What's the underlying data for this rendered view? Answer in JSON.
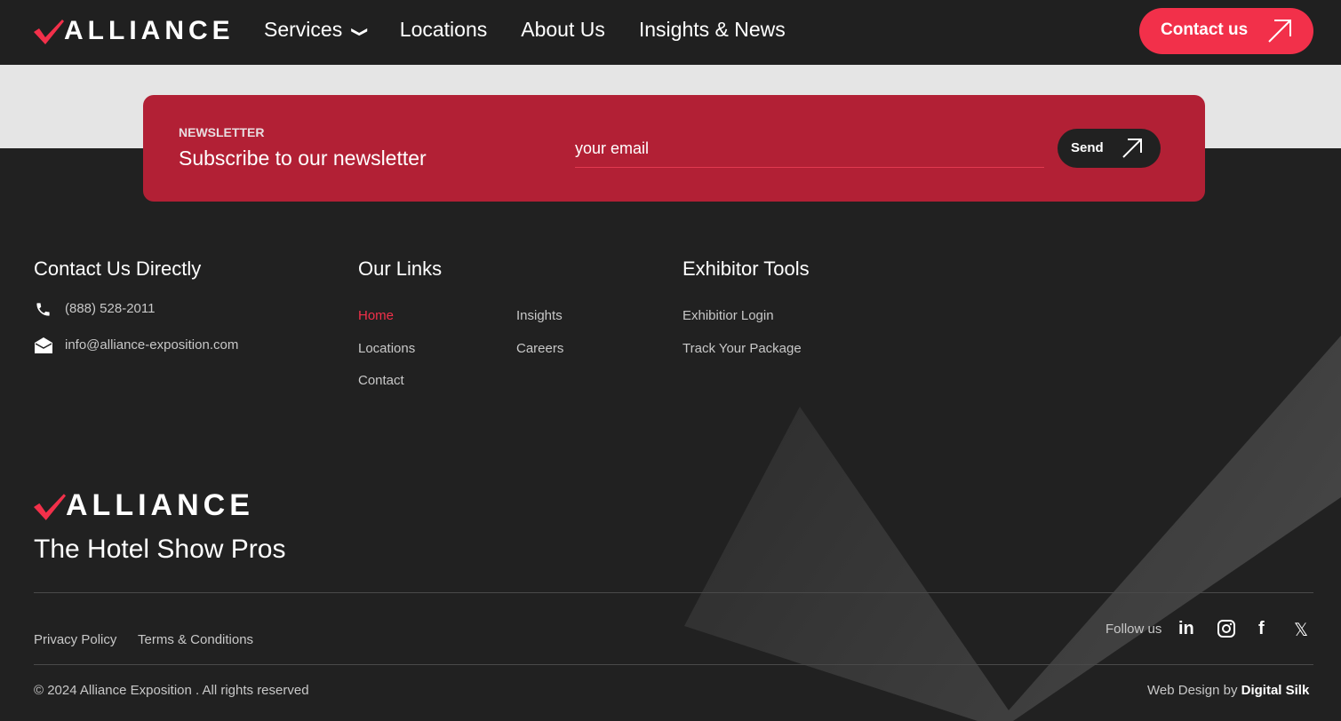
{
  "header": {
    "logo_text": "ALLIANCE",
    "nav": [
      "Services",
      "Locations",
      "About Us",
      "Insights & News"
    ],
    "cta": "Contact us"
  },
  "newsletter": {
    "label": "NEWSLETTER",
    "title": "Subscribe to our newsletter",
    "email_placeholder": "your email",
    "send": "Send"
  },
  "contact": {
    "title": "Contact Us Directly",
    "phone": "(888) 528-2011",
    "email": "info@alliance-exposition.com"
  },
  "links": {
    "title": "Our Links",
    "items": [
      "Home",
      "Insights",
      "Locations",
      "Careers",
      "Contact"
    ]
  },
  "tools": {
    "title": "Exhibitor Tools",
    "items": [
      "Exhibitior Login",
      "Track Your Package"
    ]
  },
  "footer": {
    "logo_text": "ALLIANCE",
    "tagline": "The Hotel Show Pros",
    "privacy": "Privacy Policy",
    "terms": "Terms & Conditions",
    "follow": "Follow us",
    "copyright": "© 2024 Alliance Exposition . All rights reserved",
    "credit_prefix": "Web Design by",
    "credit_name": "Digital Silk"
  },
  "colors": {
    "accent": "#f2304a",
    "newsletter_bg": "#b22035",
    "bg": "#212121"
  }
}
